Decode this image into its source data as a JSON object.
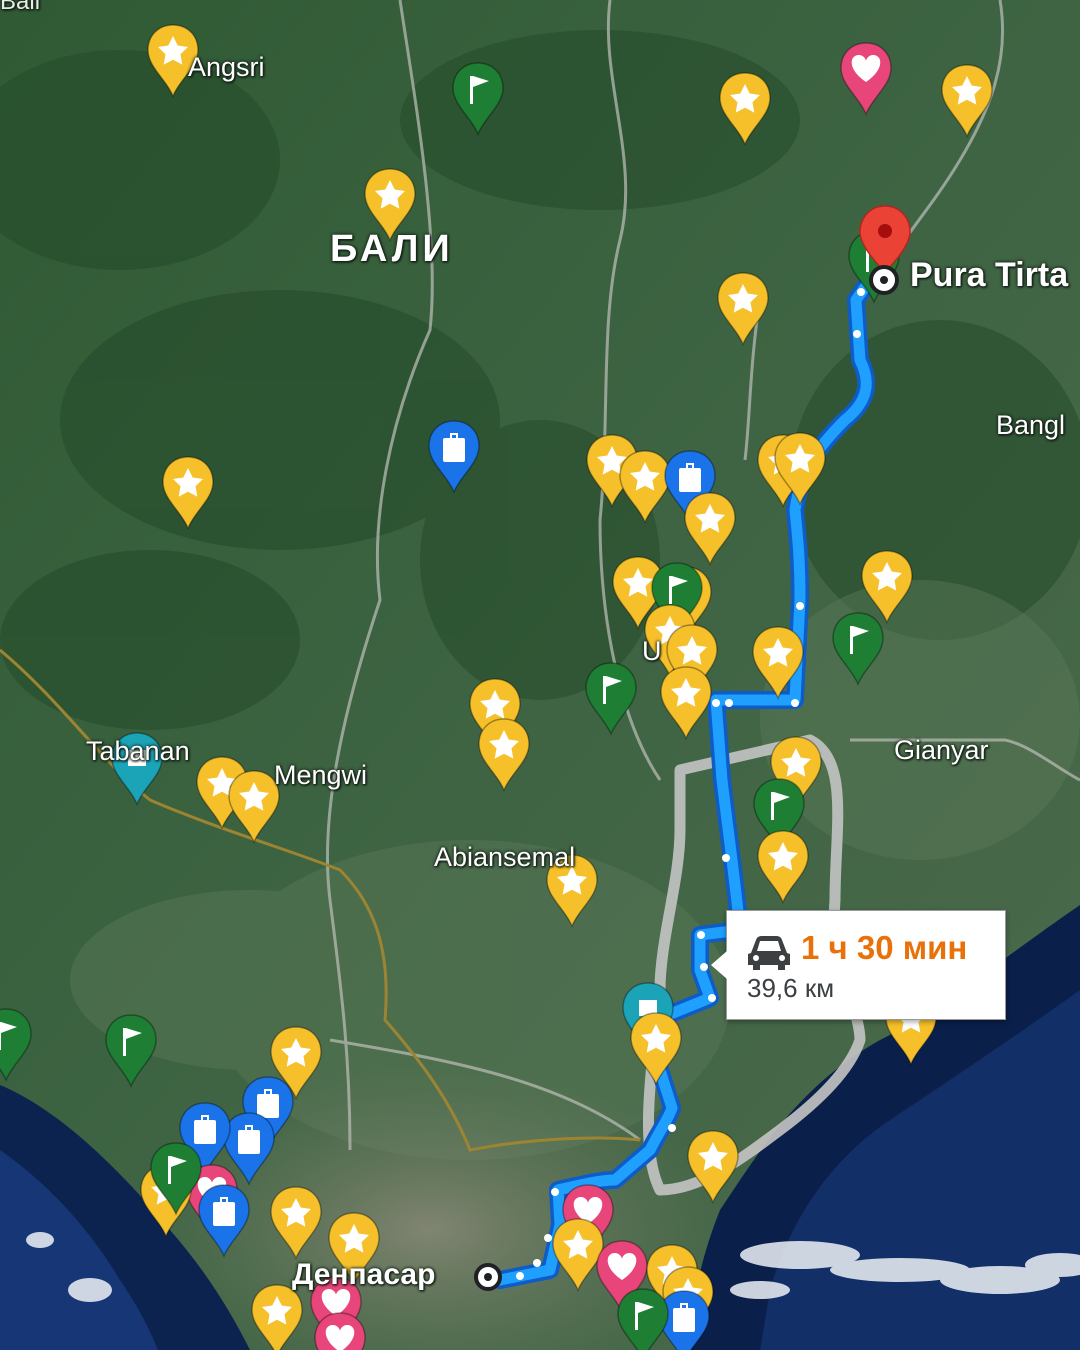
{
  "map": {
    "labels": {
      "corner": "Bali",
      "angsri": "Angsri",
      "region": "БАЛИ",
      "destination": "Pura Tirta",
      "bangli": "Bangl",
      "tabanan": "Tabanan",
      "mengwi": "Mengwi",
      "abiansemal": "Abiansemal",
      "gianyar": "Gianyar",
      "ubud": "U",
      "denpasar": "Денпасар"
    },
    "route": {
      "duration": "1 ч 30 мин",
      "distance": "39,6 км",
      "mode_icon": "car-icon",
      "color": "#1a73e8"
    },
    "colors": {
      "star_pin": "#f5c02a",
      "flag_pin": "#1e7e34",
      "luggage_pin": "#1a73e8",
      "heart_pin": "#e8457a",
      "teal_pin": "#1ba3b8",
      "destination_pin": "#ea4335"
    },
    "pin_icons": {
      "star": "star-icon",
      "flag": "flag-icon",
      "luggage": "luggage-icon",
      "heart": "heart-icon",
      "teal": "square-icon"
    }
  }
}
